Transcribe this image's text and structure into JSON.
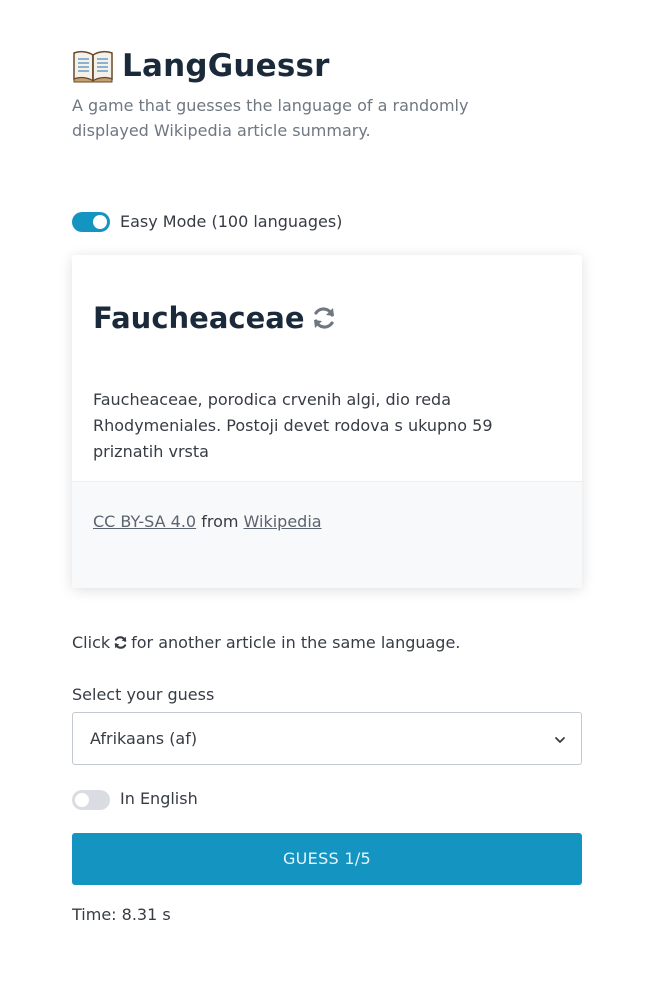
{
  "header": {
    "title": "LangGuessr",
    "subtitle": "A game that guesses the language of a randomly displayed Wikipedia article summary."
  },
  "easy_mode": {
    "label": "Easy Mode (100 languages)",
    "enabled": true
  },
  "article": {
    "title": "Faucheaceae",
    "summary": "Faucheaceae, porodica crvenih algi, dio reda Rhodymeniales. Postoji devet rodova s ukupno 59 priznatih vrsta",
    "license_link": "CC BY-SA 4.0",
    "from_text": "from",
    "source_link": "Wikipedia"
  },
  "hint": {
    "before": "Click",
    "after": "for another article in the same language."
  },
  "guess": {
    "label": "Select your guess",
    "selected": "Afrikaans (af)"
  },
  "in_english": {
    "label": "In English",
    "enabled": false
  },
  "guess_button": {
    "label": "GUESS 1/5"
  },
  "timer": {
    "text": "Time: 8.31 s"
  },
  "colors": {
    "accent": "#1495c1",
    "title": "#1b2a3a",
    "text": "#373c44",
    "muted": "#6f7781"
  },
  "icons": {
    "logo": "open-book-icon",
    "refresh": "refresh-icon",
    "dropdown": "chevron-down-icon"
  }
}
